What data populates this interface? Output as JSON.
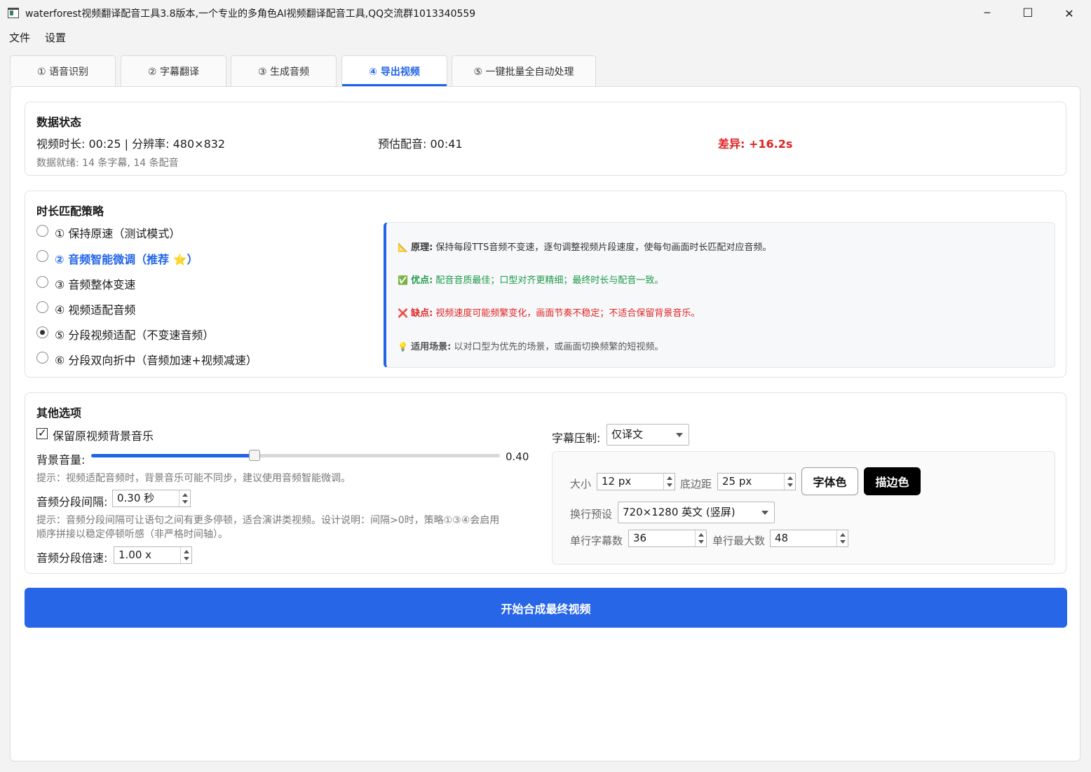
{
  "window": {
    "title": "waterforest视频翻译配音工具3.8版本,一个专业的多角色AI视频翻译配音工具,QQ交流群1013340559",
    "minimize": "─",
    "maximize": "☐",
    "close": "✕"
  },
  "menu": {
    "items": [
      "文件",
      "设置"
    ]
  },
  "tabs": [
    {
      "label": "① 语音识别"
    },
    {
      "label": "② 字幕翻译"
    },
    {
      "label": "③ 生成音频"
    },
    {
      "label": "④ 导出视频",
      "active": true
    },
    {
      "label": "⑤ 一键批量全自动处理"
    }
  ],
  "data_status": {
    "title": "数据状态",
    "video_info": "视频时长: 00:25 | 分辨率: 480×832",
    "estimated_dub": "预估配音: 00:41",
    "diff": "差异: +16.2s",
    "ready": "数据就绪: 14 条字幕, 14 条配音"
  },
  "strategy": {
    "title": "时长匹配策略",
    "options": [
      {
        "label": "① 保持原速（测试模式）",
        "checked": false
      },
      {
        "label": "② 音频智能微调（推荐 ⭐）",
        "checked": false,
        "highlight": true
      },
      {
        "label": "③ 音频整体变速",
        "checked": false
      },
      {
        "label": "④ 视频适配音频",
        "checked": false
      },
      {
        "label": "⑤ 分段视频适配（不变速音频）",
        "checked": true
      },
      {
        "label": "⑥ 分段双向折中（音频加速+视频减速）",
        "checked": false
      }
    ],
    "info": {
      "principle_icon": "📐",
      "principle_label": "原理:",
      "principle_text": " 保持每段TTS音频不变速，逐句调整视频片段速度，使每句画面时长匹配对应音频。",
      "pros_icon": "✅",
      "pros_label": "优点:",
      "pros_text": " 配音音质最佳；口型对齐更精细；最终时长与配音一致。",
      "cons_icon": "❌",
      "cons_label": "缺点:",
      "cons_text": " 视频速度可能频繁变化，画面节奏不稳定；不适合保留背景音乐。",
      "scene_icon": "💡",
      "scene_label": "适用场景:",
      "scene_text": " 以对口型为优先的场景，或画面切换频繁的短视频。",
      "colors": {
        "principle": "#333333",
        "pros": "#1e9a4a",
        "cons": "#e02424",
        "scene": "#555555"
      }
    }
  },
  "other": {
    "title": "其他选项",
    "keep_bgm": {
      "label": "保留原视频背景音乐",
      "checked": true
    },
    "bg_volume": {
      "label": "背景音量:",
      "value": "0.40",
      "level": 0.4
    },
    "hint1": "提示：视频适配音频时，背景音乐可能不同步，建议使用音频智能微调。",
    "gap": {
      "label": "音频分段间隔:",
      "value": "0.30 秒"
    },
    "hint2_line1": "提示：音频分段间隔可让语句之间有更多停顿，适合演讲类视频。设计说明：间隔>0时，策略①③④会启用",
    "hint2_line2": "顺序拼接以稳定停顿听感（非严格时间轴）。",
    "speed": {
      "label": "音频分段倍速:",
      "value": "1.00 x"
    },
    "subtitle": {
      "burn_label": "字幕压制:",
      "burn_value": "仅译文",
      "size_label": "大小",
      "size_value": "12 px",
      "margin_label": "底边距",
      "margin_value": "25 px",
      "font_color_btn": "字体色",
      "stroke_color_btn": "描边色",
      "preset_label": "换行预设",
      "preset_value": "720×1280 英文 (竖屏)",
      "line_count_label": "单行字幕数",
      "line_count_value": "36",
      "max_label": "单行最大数",
      "max_value": "48"
    }
  },
  "actions": {
    "start": "开始合成最终视频"
  },
  "colors": {
    "accent": "#2164e8",
    "primary_button": "#2766e6",
    "diff_red": "#e02020"
  }
}
